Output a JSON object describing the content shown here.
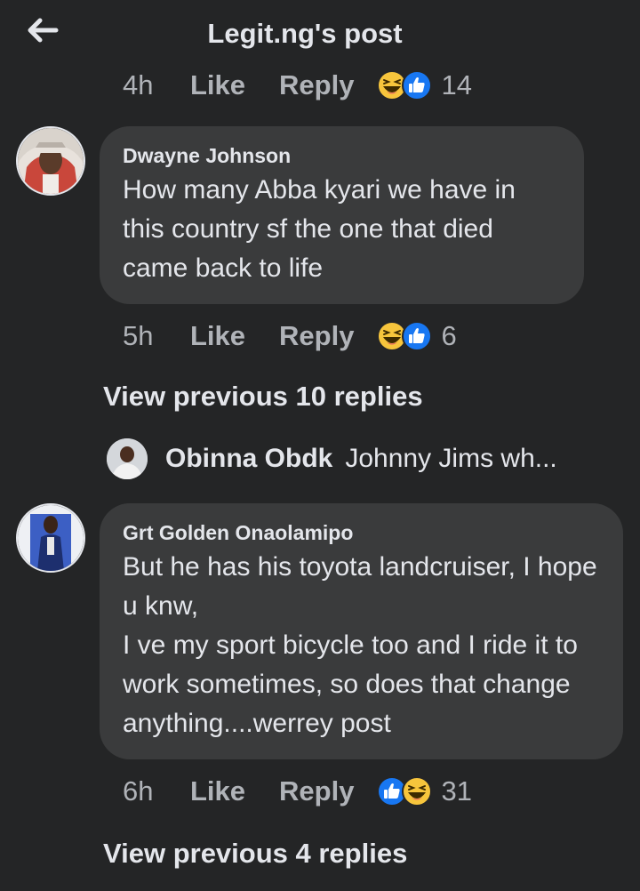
{
  "header": {
    "title": "Legit.ng's post",
    "back_icon": "arrow-left-icon"
  },
  "top_meta": {
    "time": "4h",
    "like": "Like",
    "reply": "Reply",
    "reaction_count": "14"
  },
  "comments": [
    {
      "author": "Dwayne Johnson",
      "text": "How many Abba kyari we have in this country sf the one that died came back to life",
      "time": "5h",
      "like": "Like",
      "reply": "Reply",
      "reaction_count": "6"
    },
    {
      "author": "Grt Golden Onaolamipo",
      "text": "But he has his toyota landcruiser, I hope u knw,\nI ve my sport bicycle too and I ride it to work sometimes, so does that change anything....werrey post",
      "time": "6h",
      "like": "Like",
      "reply": "Reply",
      "reaction_count": "31"
    }
  ],
  "view_previous_1": "View previous 10 replies",
  "reply_preview": {
    "author": "Obinna Obdk",
    "text": "Johnny Jims wh..."
  },
  "view_previous_2": "View previous 4 replies",
  "colors": {
    "background": "#242526",
    "bubble": "#3a3b3c",
    "text": "#e4e6eb",
    "secondary": "#b0b3b8",
    "like_blue": "#1877f2",
    "haha_yellow": "#f7c53c"
  }
}
